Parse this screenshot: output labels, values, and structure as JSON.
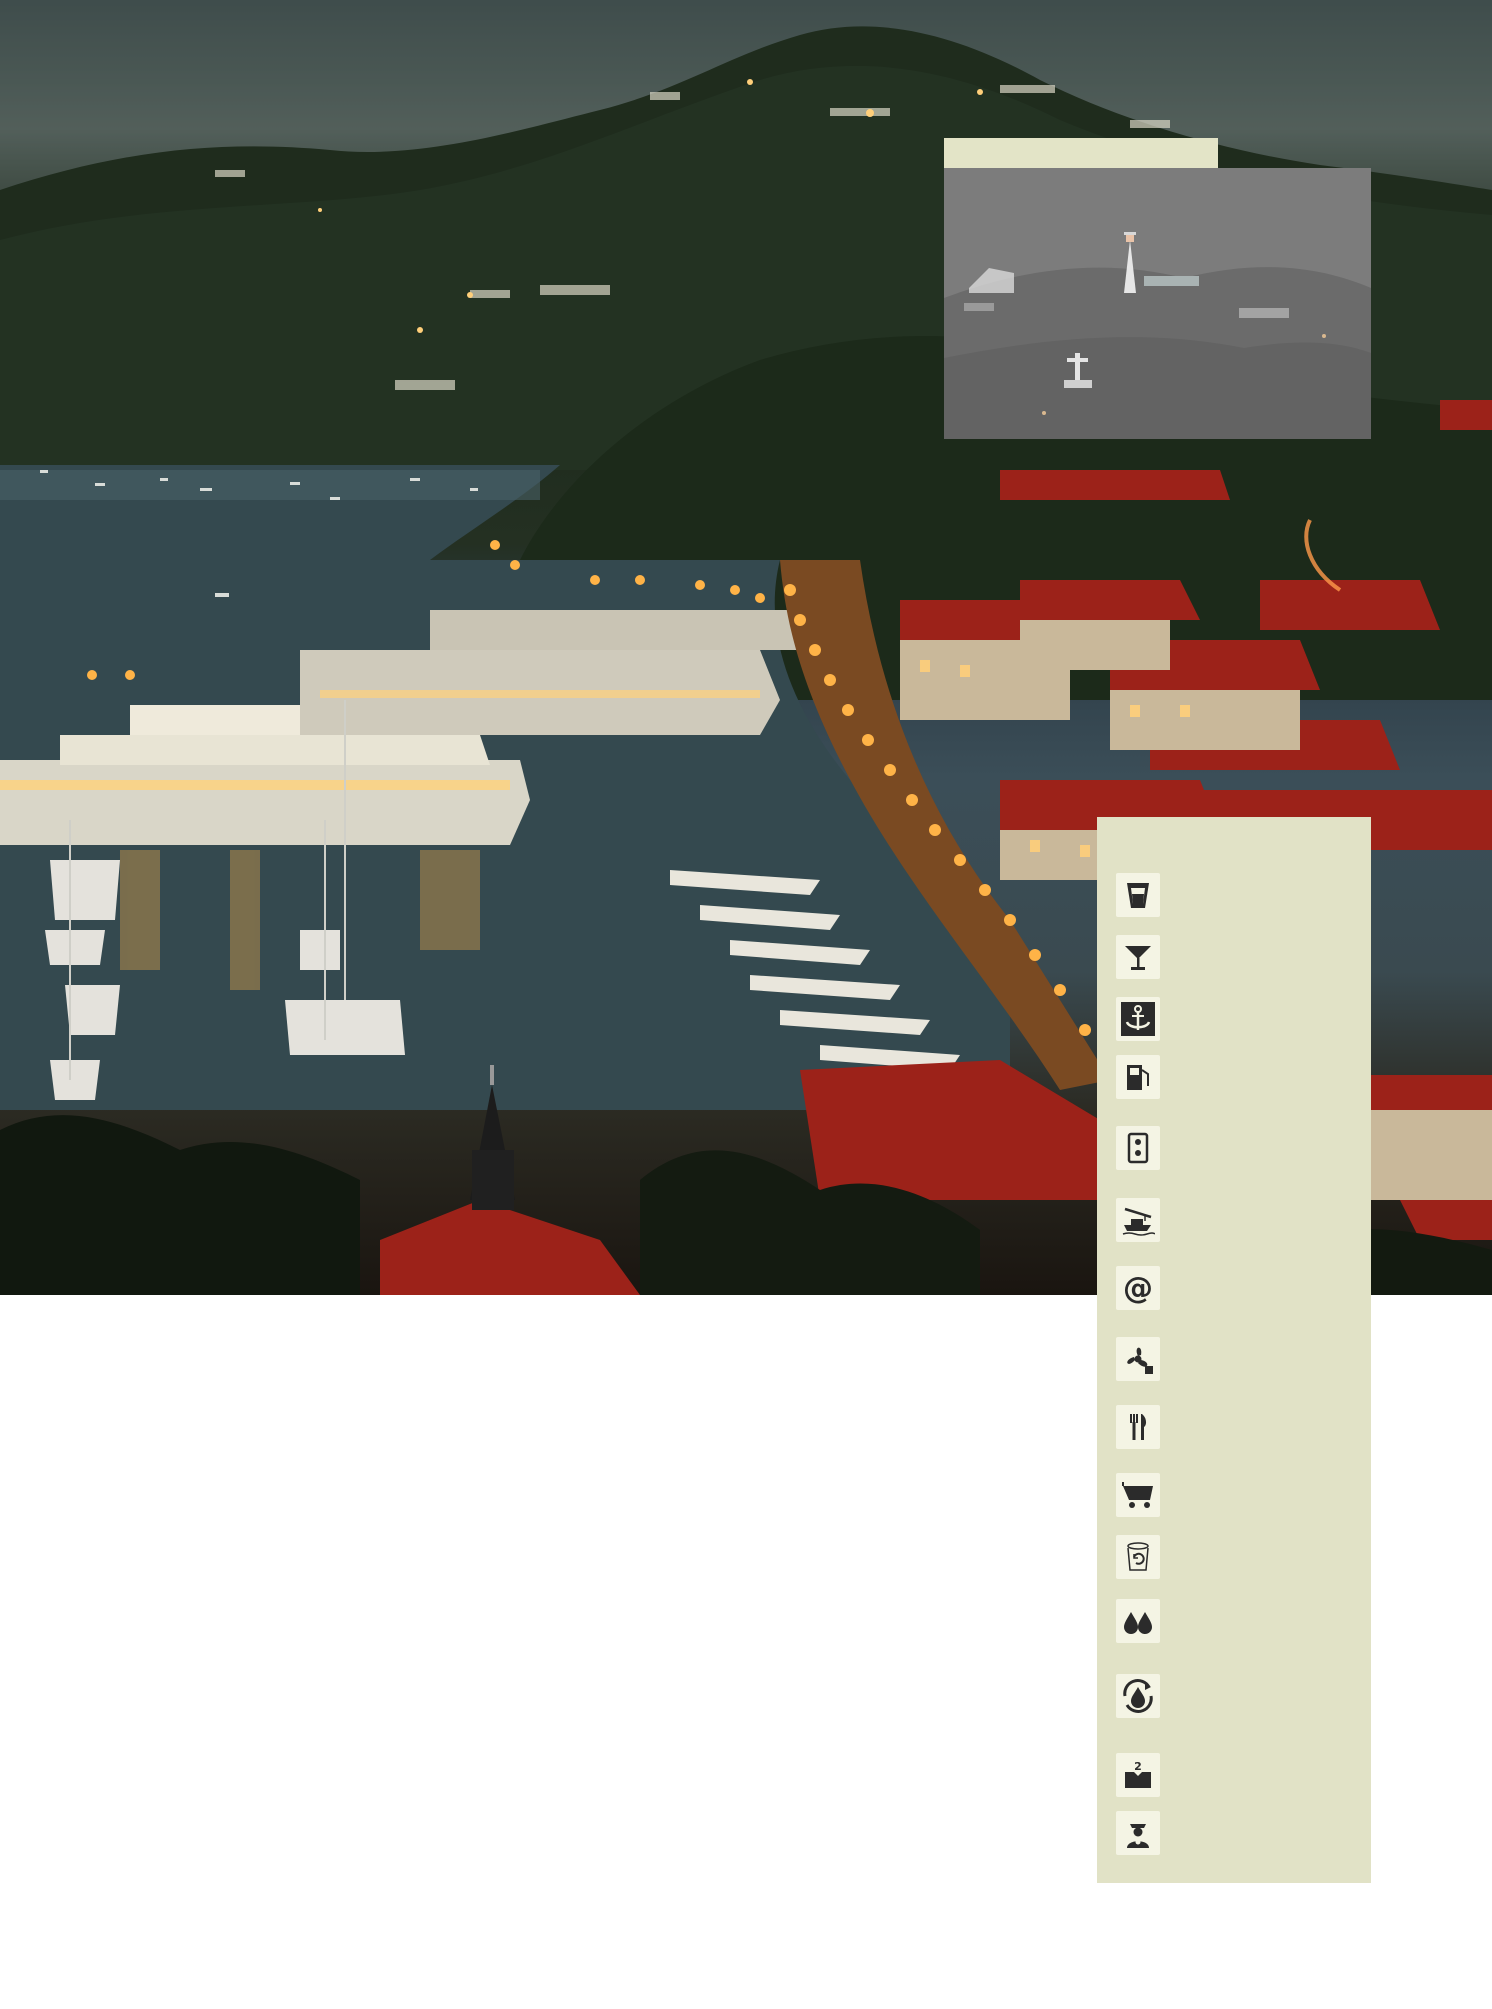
{
  "colors": {
    "panel": "#e1e2c6",
    "panel_tab": "#e3e4c7",
    "icon_tile": "#f4f4e4",
    "icon_ink": "#2b2b2b",
    "town_lights": "#ffb347",
    "roofs": "#a8241c"
  },
  "amenities": [
    {
      "icon": "water-glass-icon"
    },
    {
      "icon": "cocktail-bar-icon"
    },
    {
      "icon": "anchor-icon"
    },
    {
      "icon": "fuel-pump-icon"
    },
    {
      "icon": "power-outlet-icon"
    },
    {
      "icon": "boat-lift-icon"
    },
    {
      "icon": "internet-at-icon"
    },
    {
      "icon": "propeller-repair-icon"
    },
    {
      "icon": "restaurant-icon"
    },
    {
      "icon": "shopping-cart-icon"
    },
    {
      "icon": "recycling-icon"
    },
    {
      "icon": "water-drops-icon"
    },
    {
      "icon": "pump-out-icon"
    },
    {
      "icon": "laundry-icon"
    },
    {
      "icon": "customs-officer-icon"
    }
  ]
}
